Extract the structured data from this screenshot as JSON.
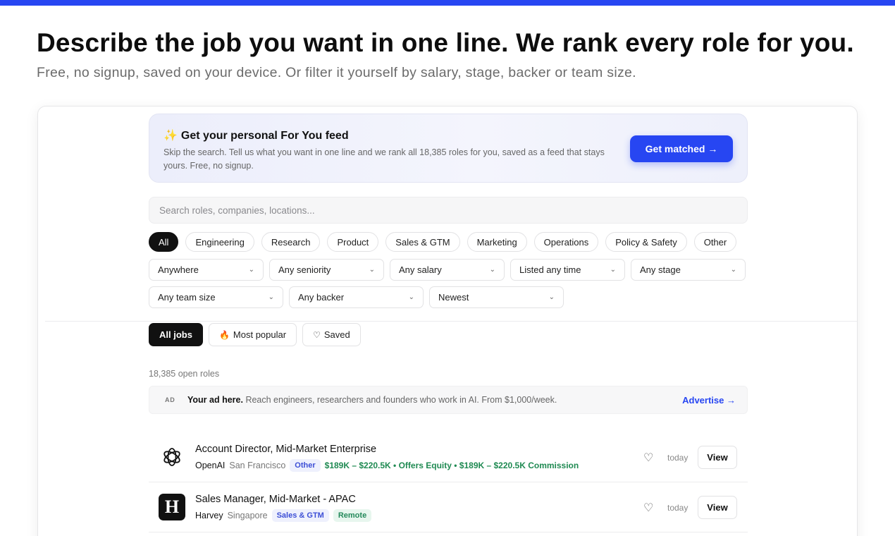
{
  "hero": {
    "title": "Describe the job you want in one line. We rank every role for you.",
    "subtitle": "Free, no signup, saved on your device. Or filter it yourself by salary, stage, backer or team size."
  },
  "promo": {
    "icon": "sparkles-icon",
    "title": "Get your personal For You feed",
    "description": "Skip the search. Tell us what you want in one line and we rank all 18,385 roles for you, saved as a feed that stays yours. Free, no signup.",
    "button": "Get matched →"
  },
  "search": {
    "placeholder": "Search roles, companies, locations..."
  },
  "categories": [
    "All",
    "Engineering",
    "Research",
    "Product",
    "Sales & GTM",
    "Marketing",
    "Operations",
    "Policy & Safety",
    "Other"
  ],
  "filters": {
    "location": "Anywhere",
    "seniority": "Any seniority",
    "salary": "Any salary",
    "listed": "Listed any time",
    "stage": "Any stage",
    "team_size": "Any team size",
    "backer": "Any backer",
    "sort": "Newest"
  },
  "view_tabs": {
    "all": "All jobs",
    "popular": "Most popular",
    "saved": "Saved"
  },
  "results_count": "18,385 open roles",
  "ad": {
    "tag": "AD",
    "headline": "Your ad here.",
    "text": "Reach engineers, researchers and founders who work in AI. From $1,000/week.",
    "link": "Advertise →"
  },
  "jobs": [
    {
      "title": "Account Director, Mid-Market Enterprise",
      "company": "OpenAI",
      "location": "San Francisco",
      "category": "Other",
      "salary": "$189K – $220.5K • Offers Equity • $189K – $220.5K Commission",
      "posted": "today",
      "view": "View"
    },
    {
      "title": "Sales Manager, Mid-Market - APAC",
      "company": "Harvey",
      "logo_letter": "H",
      "location": "Singapore",
      "category": "Sales & GTM",
      "badge": "Remote",
      "posted": "today",
      "view": "View"
    }
  ],
  "colors": {
    "accent": "#2746f2",
    "salary": "#1f8a52",
    "category_tag": "#3d4fd6",
    "remote_tag": "#23895a"
  }
}
